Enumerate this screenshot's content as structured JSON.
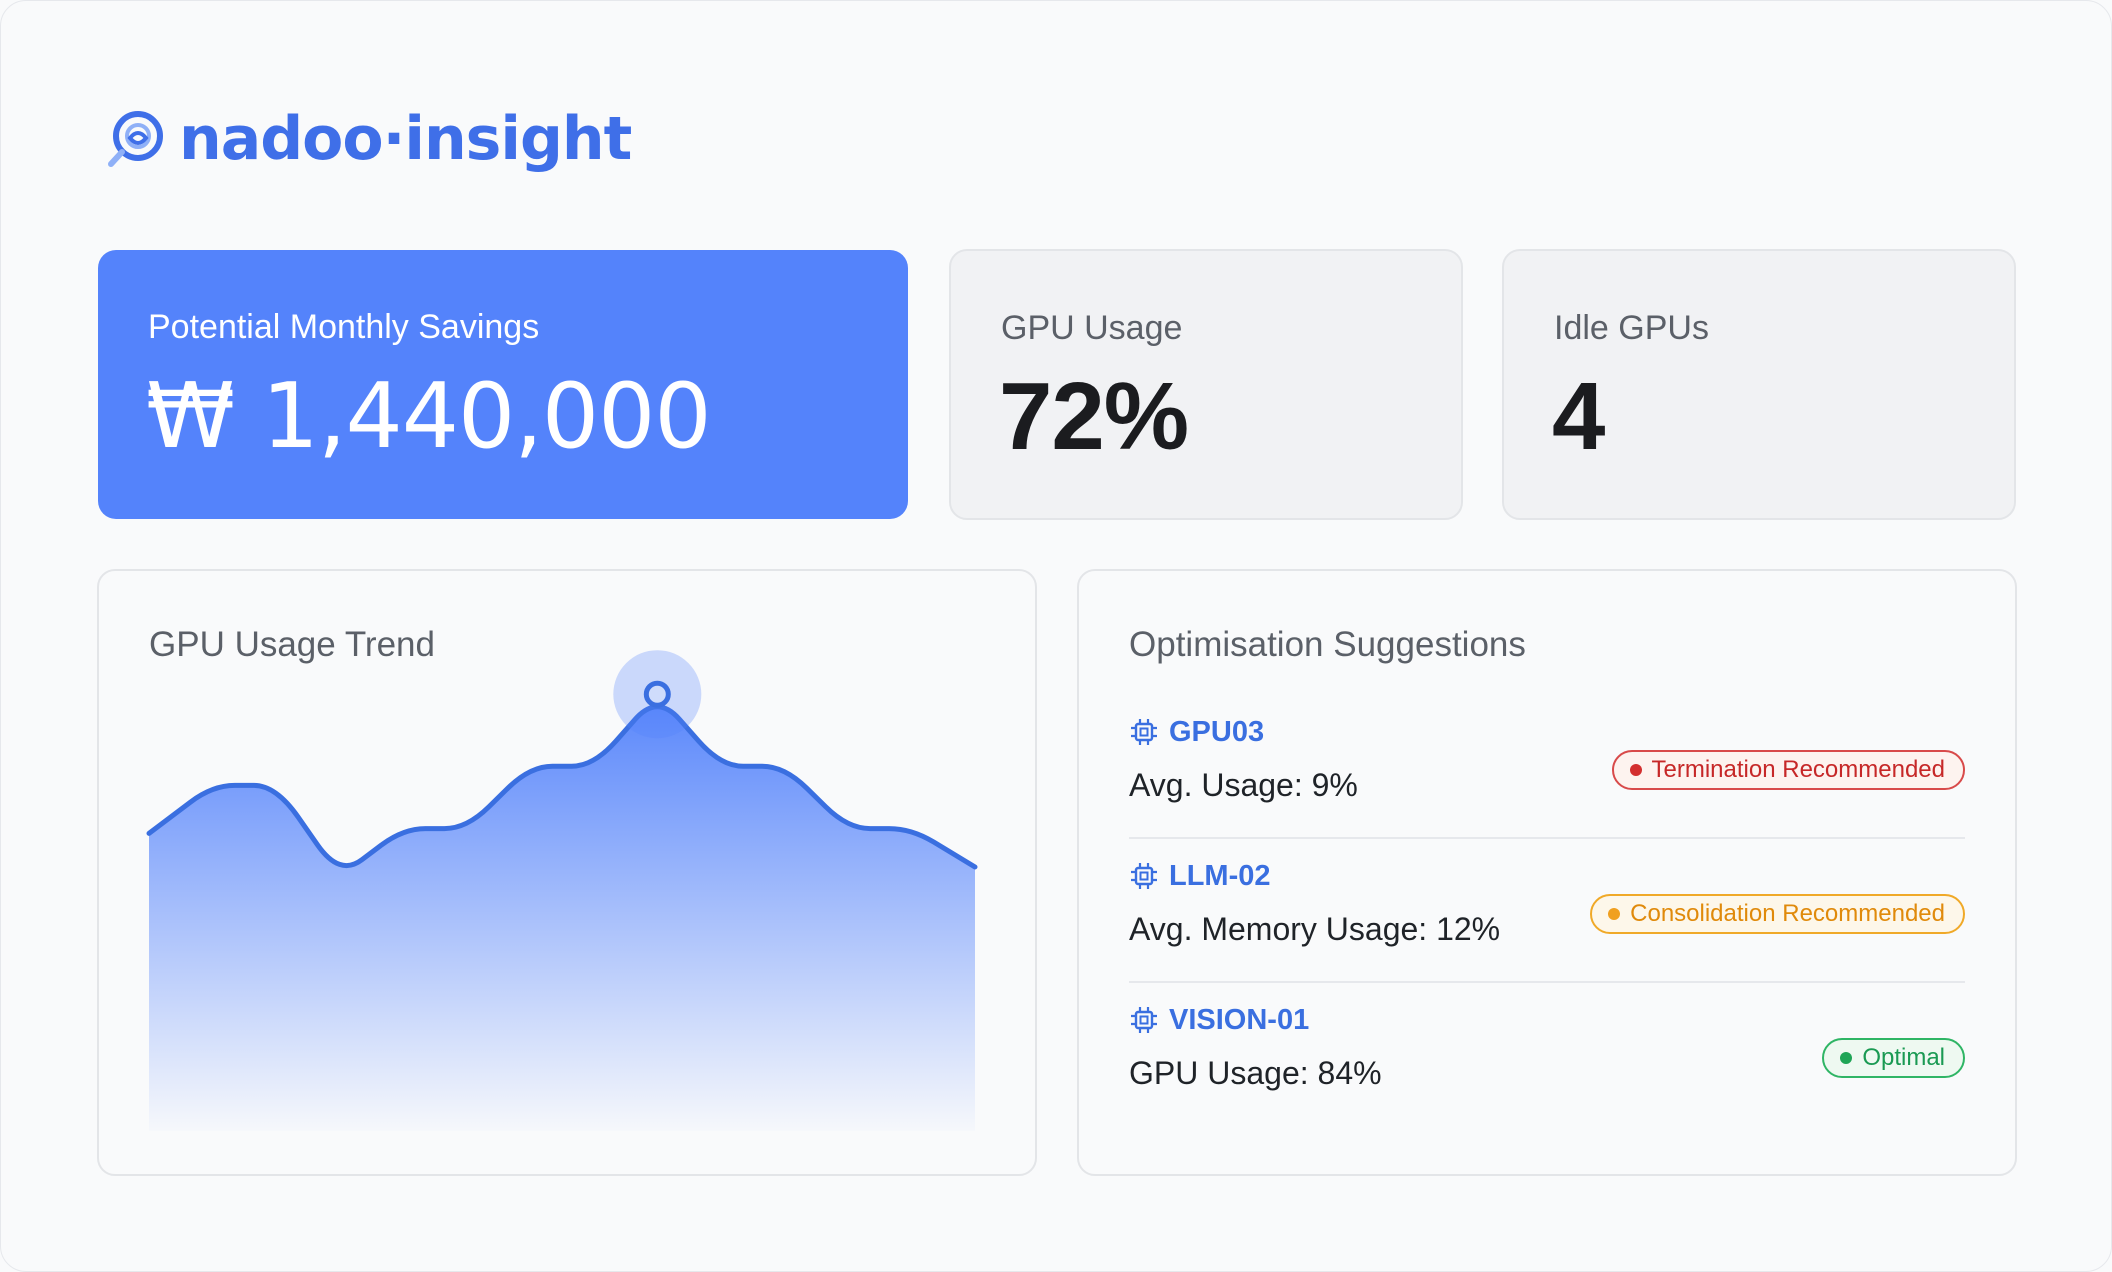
{
  "brand": {
    "name": "nadoo·insight",
    "accent": "#3f6fe8"
  },
  "kpis": {
    "savings": {
      "label": "Potential Monthly Savings",
      "value": "₩ 1,440,000",
      "bg": "#5483fb"
    },
    "gpu_usage": {
      "label": "GPU Usage",
      "value": "72%"
    },
    "idle_gpus": {
      "label": "Idle GPUs",
      "value": "4"
    }
  },
  "trend": {
    "title": "GPU Usage Trend",
    "line_color": "#3a6fe0",
    "chart_data": {
      "type": "area",
      "title": "GPU Usage Trend",
      "values": [
        62,
        72,
        72,
        53,
        63,
        63,
        76,
        76,
        91,
        76,
        76,
        63,
        63,
        55
      ],
      "highlight_index": 8,
      "ylim": [
        0,
        100
      ],
      "grid": false,
      "legend": "none"
    }
  },
  "suggestions": {
    "title": "Optimisation Suggestions",
    "items": [
      {
        "name": "GPU03",
        "metric": "Avg. Usage: 9%",
        "status": "Termination Recommended",
        "tone": "red"
      },
      {
        "name": "LLM-02",
        "metric": "Avg. Memory Usage: 12%",
        "status": "Consolidation Recommended",
        "tone": "amber"
      },
      {
        "name": "VISION-01",
        "metric": "GPU Usage: 84%",
        "status": "Optimal",
        "tone": "green"
      }
    ],
    "tones": {
      "red": {
        "fg": "#c62828",
        "bg": "#fdf3ef",
        "border": "#d84a4a",
        "dot": "#d32f2f"
      },
      "amber": {
        "fg": "#e08a0b",
        "bg": "#fdf7ea",
        "border": "#f0a928",
        "dot": "#f0a020"
      },
      "green": {
        "fg": "#1a9a53",
        "bg": "#eef9f1",
        "border": "#2fb565",
        "dot": "#1fa556"
      }
    }
  }
}
